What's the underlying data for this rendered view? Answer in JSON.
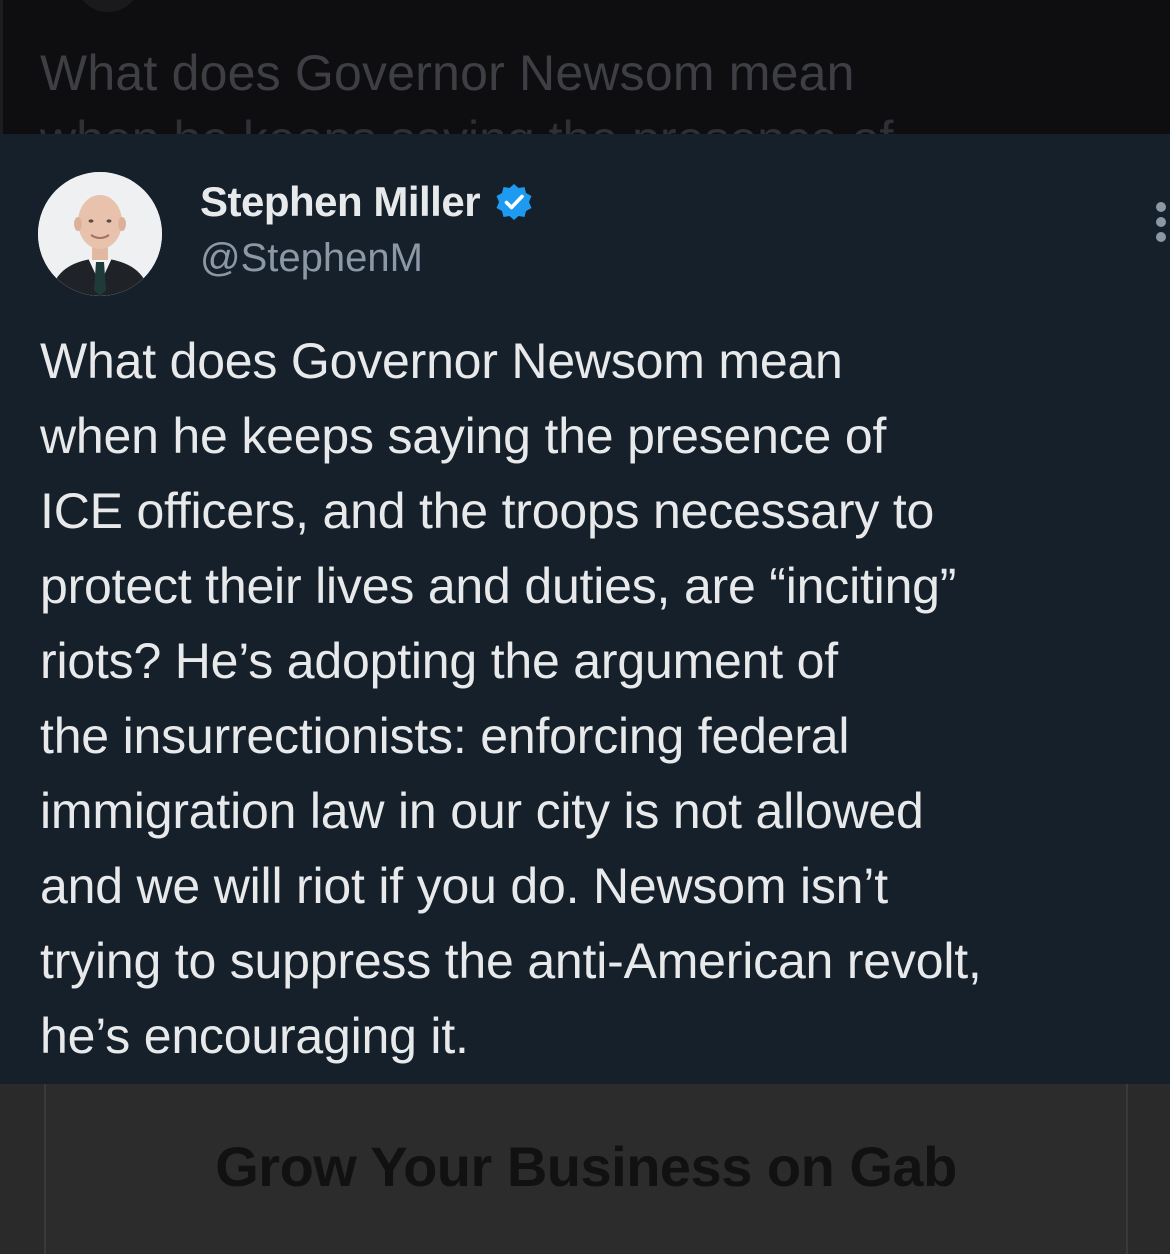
{
  "background_post": {
    "text_line1": "What does Governor Newsom mean",
    "text_line2": "when he keeps saying the presence of"
  },
  "tweet": {
    "author_name": "Stephen Miller",
    "author_handle": "@StephenM",
    "verified": true,
    "verified_icon": "verified-badge-icon",
    "more_icon": "more-options-icon",
    "body": "What does Governor Newsom mean\nwhen he keeps saying the presence of\nICE officers, and the troops necessary to\nprotect their lives and duties, are “inciting”\nriots? He’s adopting the argument of\nthe insurrectionists: enforcing federal\nimmigration law in our city is not allowed\nand we will riot if you do. Newsom isn’t\ntrying to suppress the anti-American revolt,\nhe’s encouraging it."
  },
  "ad": {
    "text": "Grow Your Business on Gab"
  },
  "colors": {
    "card_background": "#16202b",
    "verified_blue": "#1d9bf0",
    "handle_gray": "#8b98a5",
    "text_white": "#e7e9ea"
  }
}
